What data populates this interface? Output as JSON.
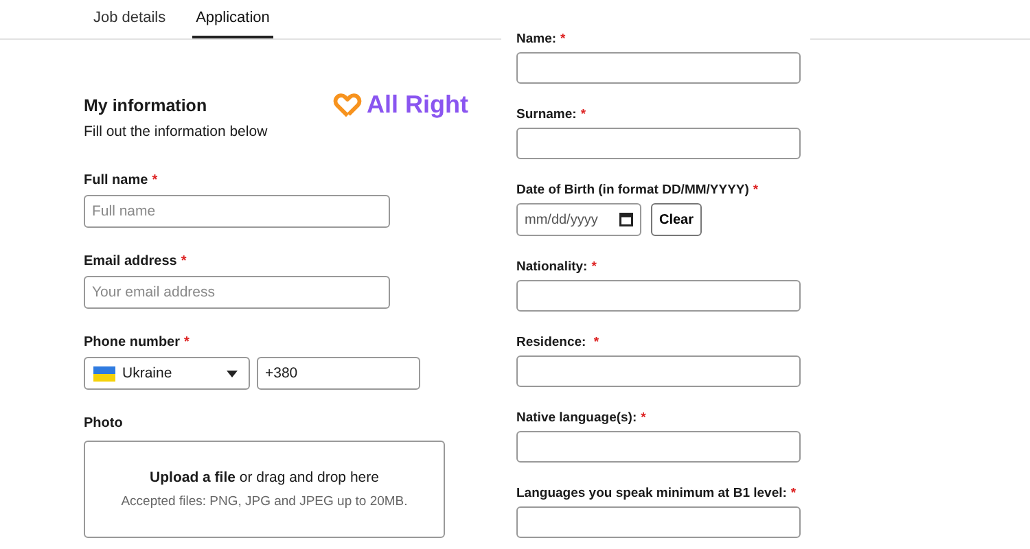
{
  "tabs": [
    {
      "label": "Job details",
      "selected": false
    },
    {
      "label": "Application",
      "selected": true
    }
  ],
  "section": {
    "title": "My information",
    "subtitle": "Fill out the information below"
  },
  "logo": {
    "text": "All Right"
  },
  "left_fields": [
    {
      "kind": "text",
      "label": "Full name",
      "required_mark": "*",
      "placeholder": "Full name"
    },
    {
      "kind": "text",
      "label": "Email address",
      "required_mark": "*",
      "placeholder": "Your email address"
    },
    {
      "kind": "phone",
      "label": "Phone number",
      "required_mark": "*",
      "country": "Ukraine",
      "value": "+380"
    },
    {
      "kind": "upload",
      "label": "Photo",
      "prompt": "**Upload a file** or drag and drop here",
      "hint": "Accepted files: PNG, JPG and JPEG up to 20MB."
    }
  ],
  "right_fields": [
    {
      "kind": "text",
      "label": "Name:",
      "required_mark": "*"
    },
    {
      "kind": "text",
      "label": "Surname:",
      "required_mark": "*"
    },
    {
      "kind": "date",
      "label": "Date of Birth (in format DD/MM/YYYY)",
      "required_mark": "*",
      "placeholder": "mm/dd/yyyy",
      "button": "Clear"
    },
    {
      "kind": "text",
      "label": "Nationality:",
      "required_mark": "*"
    },
    {
      "kind": "text",
      "label": "Residence: ",
      "required_mark": "*"
    },
    {
      "kind": "text",
      "label": "Native language(s):",
      "required_mark": "*"
    },
    {
      "kind": "text",
      "label": "Languages you speak minimum at B1 level:",
      "required_mark": "*"
    }
  ]
}
